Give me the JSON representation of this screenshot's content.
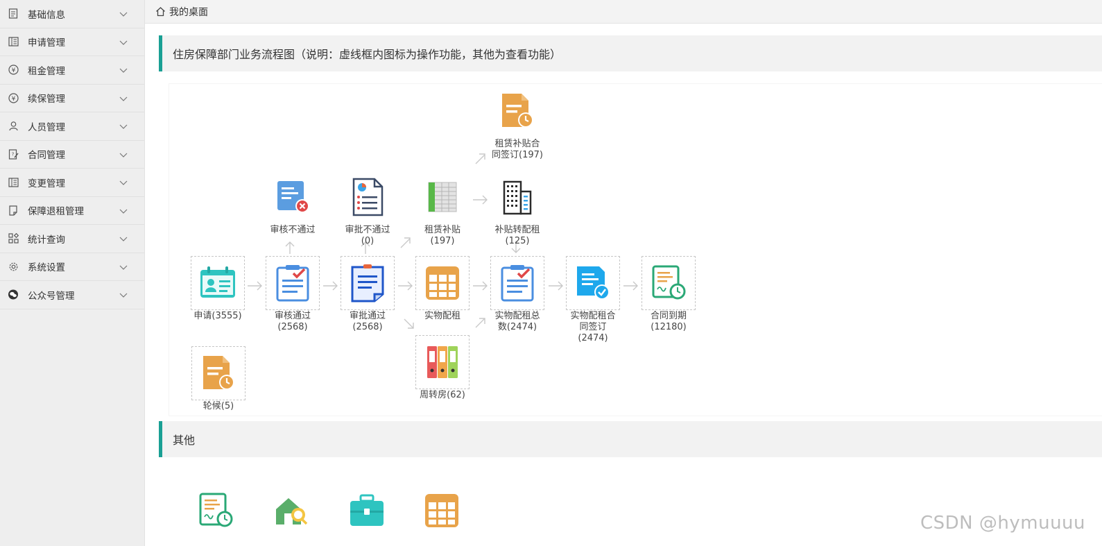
{
  "sidebar": {
    "items": [
      {
        "label": "基础信息",
        "icon": "document-icon"
      },
      {
        "label": "申请管理",
        "icon": "apply-icon"
      },
      {
        "label": "租金管理",
        "icon": "yen-icon"
      },
      {
        "label": "续保管理",
        "icon": "yen-icon"
      },
      {
        "label": "人员管理",
        "icon": "user-icon"
      },
      {
        "label": "合同管理",
        "icon": "contract-icon"
      },
      {
        "label": "变更管理",
        "icon": "apply-icon"
      },
      {
        "label": "保障退租管理",
        "icon": "note-icon"
      },
      {
        "label": "统计查询",
        "icon": "grid-icon"
      },
      {
        "label": "系统设置",
        "icon": "gear-icon"
      },
      {
        "label": "公众号管理",
        "icon": "wechat-icon"
      }
    ]
  },
  "topbar": {
    "title": "我的桌面"
  },
  "sections": {
    "flow_title": "住房保障部门业务流程图（说明：虚线框内图标为操作功能，其他为查看功能）",
    "other_title": "其他"
  },
  "flow": {
    "apply": {
      "line1": "申请(3555)",
      "line2": ""
    },
    "audit_pass": {
      "line1": "审核通过",
      "line2": "(2568)"
    },
    "approve_pass": {
      "line1": "审批通过",
      "line2": "(2568)"
    },
    "physical_rent": {
      "line1": "实物配租",
      "line2": ""
    },
    "physical_total": {
      "line1": "实物配租总",
      "line2": "数(2474)"
    },
    "physical_sign": {
      "line1": "实物配租合",
      "line2": "同签订",
      "line3": "(2474)"
    },
    "contract_expire": {
      "line1": "合同到期",
      "line2": "(12180)"
    },
    "audit_fail": {
      "line1": "审核不通过",
      "line2": ""
    },
    "approve_fail": {
      "line1": "审批不通过",
      "line2": "(0)"
    },
    "rent_subsidy": {
      "line1": "租赁补贴",
      "line2": "(197)"
    },
    "subsidy_to_physical": {
      "line1": "补贴转配租",
      "line2": "(125)"
    },
    "subsidy_sign": {
      "line1": "租赁补贴合",
      "line2": "同签订(197)"
    },
    "turnover": {
      "line1": "周转房(62)",
      "line2": ""
    },
    "waiting": {
      "line1": "轮候(5)",
      "line2": ""
    }
  },
  "colors": {
    "accent": "#1aa094",
    "teal": "#2ec4c0",
    "blue": "#4a8ee0",
    "orange": "#e8a34a",
    "green": "#2aa876"
  },
  "watermark": "CSDN @hymuuuu"
}
